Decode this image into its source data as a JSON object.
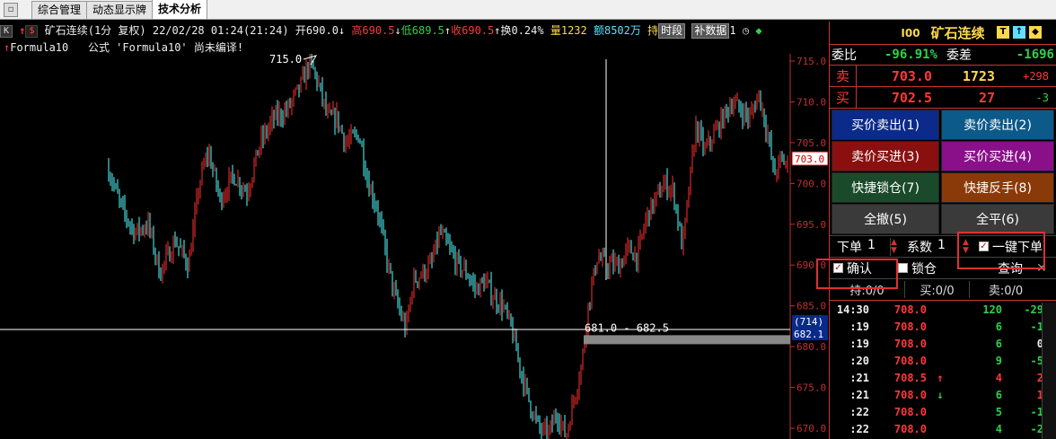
{
  "tabs": {
    "icon": "app-icon",
    "items": [
      "综合管理",
      "动态显示牌",
      "技术分析"
    ],
    "active": 2
  },
  "info": {
    "k_btn": "K",
    "s_btn": "$",
    "name": "矿石连续",
    "period": "(1分 复权)",
    "datetime": "22/02/28 01:24(21:24)",
    "open": "开690.0",
    "open_arrow": "↓",
    "high": "高690.5",
    "high_arrow": "↓",
    "low": "低689.5",
    "low_arrow": "↑",
    "close": "收690.5",
    "close_arrow": "↑",
    "turnover": "换0.24%",
    "volume": "量1232",
    "amount": "额8502万",
    "trailing": "持",
    "btn_phase": "时段",
    "btn_fill": "补数据",
    "btn_digit": "1"
  },
  "formula": {
    "name": "Formula10",
    "message": "公式 'Formula10' 尚未编译!"
  },
  "chart_data": {
    "type": "candlestick",
    "ylim": [
      667,
      717
    ],
    "yticks": [
      "715.0",
      "710.0",
      "705.0",
      "700.0",
      "695.0",
      "690.0",
      "685.0",
      "680.0",
      "675.0",
      "670.0"
    ],
    "annotations": {
      "peak": "715.0",
      "range": "681.0 - 682.5",
      "last_price": "703.0",
      "cursor_price_tag": "(714)",
      "cursor_price": "682.1"
    },
    "cursor": {
      "price": 682.1
    },
    "colors": {
      "up": "#ff3030",
      "down": "#54ffff",
      "axis": "#c03030",
      "cursor": "#ffffff",
      "band": "#888888"
    }
  },
  "quote": {
    "code": "I00",
    "name": "矿石连续",
    "icons": [
      "T",
      "↑",
      "◆"
    ],
    "weibi_label": "委比",
    "weibi": "-96.91%",
    "weicha_label": "委差",
    "weicha": "-1696",
    "sell_label": "卖",
    "sell_price": "703.0",
    "sell_vol": "1723",
    "sell_chg": "+298",
    "buy_label": "买",
    "buy_price": "702.5",
    "buy_vol": "27",
    "buy_chg": "-3"
  },
  "orders": {
    "buttons": [
      {
        "label": "买价卖出(1)",
        "color": "#0c2a8a"
      },
      {
        "label": "卖价卖出(2)",
        "color": "#0c5a8a"
      },
      {
        "label": "卖价买进(3)",
        "color": "#8a1010"
      },
      {
        "label": "买价买进(4)",
        "color": "#8a108a"
      },
      {
        "label": "快捷锁仓(7)",
        "color": "#1a4a2a"
      },
      {
        "label": "快捷反手(8)",
        "color": "#8a3a08"
      },
      {
        "label": "全撤(5)",
        "color": "#3a3a3a"
      },
      {
        "label": "全平(6)",
        "color": "#3a3a3a"
      }
    ],
    "qty_label": "下单",
    "qty_value": "1",
    "coef_label": "系数",
    "coef_value": "1",
    "one_key": "一键下单",
    "confirm": "确认",
    "lock": "锁仓",
    "query": "查询",
    "close_x": "✕",
    "hold": "持:0/0",
    "buy_pos": "买:0/0",
    "sell_pos": "卖:0/0"
  },
  "trades": [
    {
      "t": "14:30",
      "p": "708.0",
      "a": "",
      "v": "120",
      "c": "-29"
    },
    {
      "t": ":19",
      "p": "708.0",
      "a": "",
      "v": "6",
      "c": "-1"
    },
    {
      "t": ":19",
      "p": "708.0",
      "a": "",
      "v": "6",
      "c": "0"
    },
    {
      "t": ":20",
      "p": "708.0",
      "a": "",
      "v": "9",
      "c": "-5"
    },
    {
      "t": ":21",
      "p": "708.5",
      "a": "↑",
      "v": "4",
      "c": "2"
    },
    {
      "t": ":21",
      "p": "708.0",
      "a": "↓",
      "v": "6",
      "c": "1"
    },
    {
      "t": ":22",
      "p": "708.0",
      "a": "",
      "v": "5",
      "c": "-1"
    },
    {
      "t": ":22",
      "p": "708.0",
      "a": "",
      "v": "4",
      "c": "-2"
    }
  ]
}
